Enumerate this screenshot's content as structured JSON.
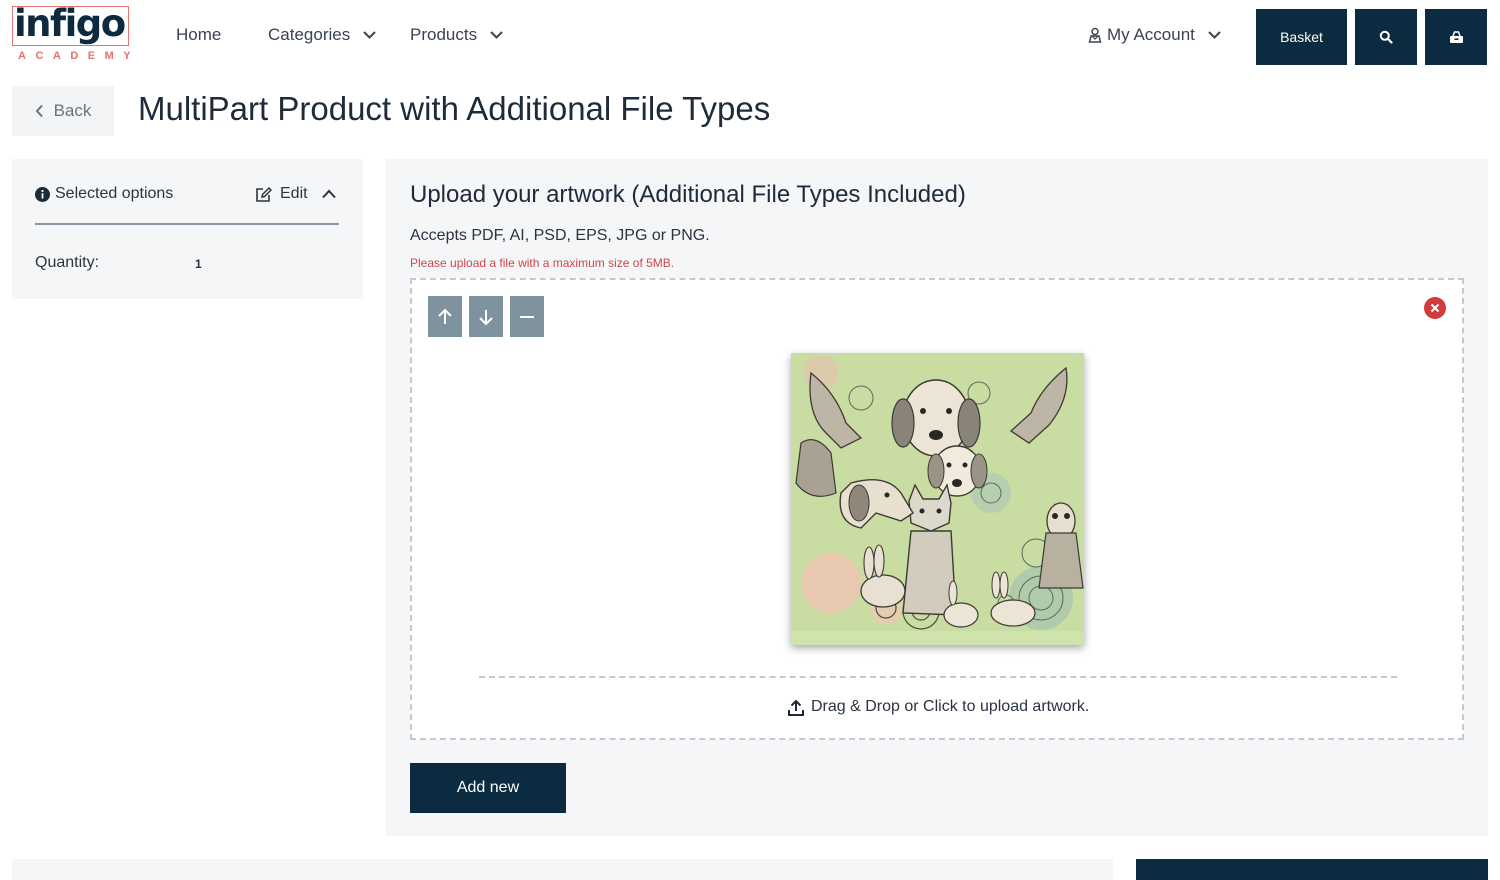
{
  "brand": {
    "logo_text": "infigo",
    "logo_sub": "ACADEMY",
    "accent": "#e0756f",
    "primary": "#0b2b40"
  },
  "nav": {
    "home": "Home",
    "categories": "Categories",
    "products": "Products",
    "account": "My Account"
  },
  "header_buttons": {
    "basket": "Basket",
    "search_icon": "search-icon",
    "checkout_icon": "cart-icon"
  },
  "back": {
    "label": "Back"
  },
  "page": {
    "title": "MultiPart Product with Additional File Types"
  },
  "sidebar": {
    "heading": "Selected options",
    "edit": "Edit",
    "options": [
      {
        "label": "Quantity:",
        "value": "1"
      }
    ]
  },
  "upload": {
    "title": "Upload your artwork (Additional File Types Included)",
    "accepts": "Accepts PDF, AI, PSD, EPS, JPG or PNG.",
    "max_size": "Please upload a file with a maximum size of 5MB.",
    "dropzone_text": "Drag & Drop or Click to upload artwork.",
    "add_new": "Add new",
    "error_color": "#d0474a"
  }
}
